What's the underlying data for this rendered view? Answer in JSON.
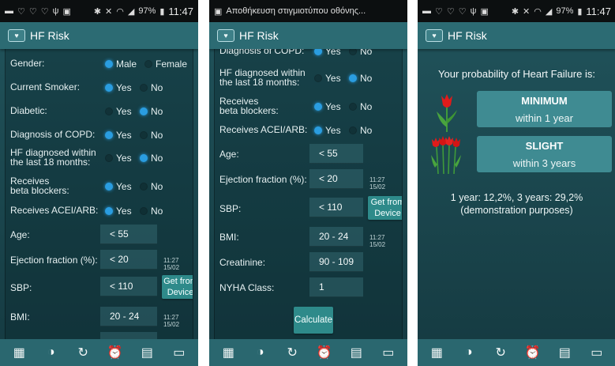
{
  "status": {
    "clock": "11:47",
    "battery": "97%",
    "screenshot_title": "Αποθήκευση στιγμιοτύπου οθόνης..."
  },
  "app": {
    "title": "HF Risk"
  },
  "form": {
    "gender": {
      "label": "Gender:",
      "option_a": "Male",
      "option_b": "Female",
      "selected": "Male"
    },
    "smoker": {
      "label": "Current Smoker:",
      "option_a": "Yes",
      "option_b": "No",
      "selected": "Yes"
    },
    "diabetic": {
      "label": "Diabetic:",
      "option_a": "Yes",
      "option_b": "No",
      "selected": "No"
    },
    "copd": {
      "label": "Diagnosis of COPD:",
      "label_cut": "Diagnosis of COPD:",
      "option_a": "Yes",
      "option_b": "No",
      "selected": "Yes"
    },
    "hf_diag": {
      "label_line1": "HF diagnosed within",
      "label_line2": "the last 18 months:",
      "option_a": "Yes",
      "option_b": "No",
      "selected": "No"
    },
    "beta": {
      "label_line1": "Receives",
      "label_line2": "beta blockers:",
      "option_a": "Yes",
      "option_b": "No",
      "selected": "Yes"
    },
    "acei": {
      "label": "Receives ACEI/ARB:",
      "option_a": "Yes",
      "option_b": "No",
      "selected": "Yes"
    },
    "age": {
      "label": "Age:",
      "value": "< 55"
    },
    "ef": {
      "label": "Ejection fraction (%):",
      "value": "< 20",
      "stamp": "11:27 15/02"
    },
    "sbp": {
      "label": "SBP:",
      "value": "< 110",
      "device_button": "Get from Device"
    },
    "bmi": {
      "label": "BMI:",
      "value": "20 - 24",
      "stamp": "11:27 15/02"
    },
    "creatinine": {
      "label": "Creatinine:",
      "value": "90 - 109"
    },
    "nyha": {
      "label": "NYHA Class:",
      "value": "1"
    },
    "calculate_button": "Calculate"
  },
  "result": {
    "heading": "Your probability of Heart Failure is:",
    "box1": {
      "level": "MINIMUM",
      "period": "within 1 year"
    },
    "box2": {
      "level": "SLIGHT",
      "period": "within 3 years"
    },
    "summary_line1": "1 year: 12,2%, 3 years: 29,2%",
    "summary_line2": "(demonstration purposes)"
  },
  "icons": {
    "bottom": [
      "calendar-grid-icon",
      "half-circle-icon",
      "refresh-icon",
      "alarm-clock-icon",
      "document-icon",
      "calendar-icon"
    ]
  },
  "colors": {
    "background_top": "#21545c",
    "background_bottom": "#153a41",
    "appbar": "#2c6b73",
    "accent_radio": "#2a9de0",
    "button": "#2e8a8a",
    "result_box": "#3f8b92"
  }
}
